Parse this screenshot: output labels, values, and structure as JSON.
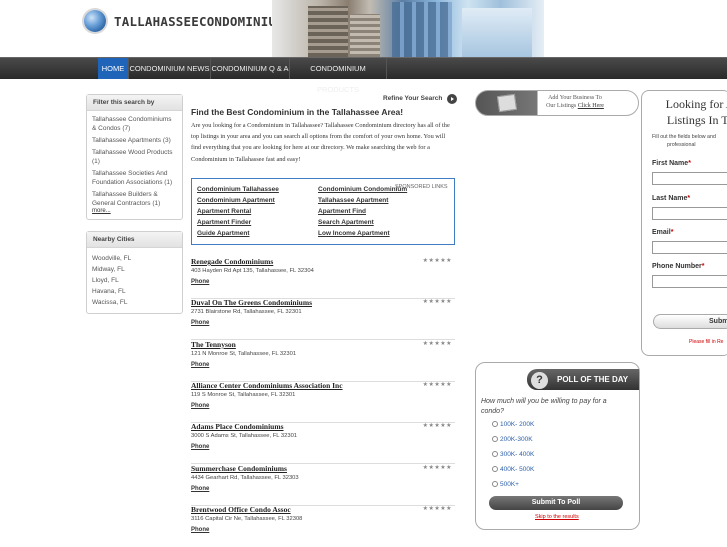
{
  "site": {
    "logo_text": "TALLAHASSEECONDOMINIUM.COM"
  },
  "nav": {
    "items": [
      "HOME",
      "CONDOMINIUM NEWS",
      "CONDOMINIUM Q & A",
      "CONDOMINIUM PRODUCTS"
    ],
    "active": "HOME"
  },
  "filter": {
    "title": "Filter this search by",
    "items": [
      "Tallahassee Condominiums",
      "& Condos (7)",
      "Tallahassee Apartments (3)",
      "Tallahassee Wood Products",
      "(1)",
      "Tallahassee Societies And",
      "Foundation Associations (1)",
      "Tallahassee Builders &",
      "General Contractors (1)"
    ],
    "more": "more..."
  },
  "nearby": {
    "title": "Nearby Cities",
    "cities": [
      "Woodville, FL",
      "Midway, FL",
      "Lloyd, FL",
      "Havana, FL",
      "Wacissa, FL"
    ]
  },
  "main": {
    "refine": "Refine Your Search",
    "title": "Find the Best Condominium in the Tallahassee Area!",
    "intro": "Are you looking for a Condominium in Tallahassee? Tallahassee Condominium directory has all of the top listings in your area and you can search all options from the comfort of your own home. You will find everything that you are looking for here at our directory. We make searching the web for a Condominium in Tallahassee fast and easy!"
  },
  "sponsored": {
    "label": "SPONSORED LINKS",
    "left": [
      "Condominium Tallahassee",
      "Condominium Apartment",
      "Apartment Rental",
      "Apartment Finder",
      "Guide Apartment"
    ],
    "right": [
      "Condominium Condominium",
      "Tallahassee Apartment",
      "Apartment Find",
      "Search Apartment",
      "Low Income Apartment"
    ]
  },
  "listings": [
    {
      "name": "Renegade Condominiums",
      "address": "403 Hayden Rd Apt 135, Tallahassee, FL 32304",
      "phone": "Phone",
      "stars": "★★★★★"
    },
    {
      "name": "Duval On The Greens Condominiums",
      "address": "2731 Blairstone Rd, Tallahassee, FL 32301",
      "phone": "Phone",
      "stars": "★★★★★"
    },
    {
      "name": "The Tennyson",
      "address": "121 N Monroe St, Tallahassee, FL 32301",
      "phone": "Phone",
      "stars": "★★★★★"
    },
    {
      "name": "Alliance Center Condominiums Association Inc",
      "address": "119 S Monroe St, Tallahassee, FL 32301",
      "phone": "Phone",
      "stars": "★★★★★"
    },
    {
      "name": "Adams Place Condominiums",
      "address": "3000 S Adams St, Tallahassee, FL 32301",
      "phone": "Phone",
      "stars": "★★★★★"
    },
    {
      "name": "Summerchase Condominiums",
      "address": "4434 Gearhart Rd, Tallahassee, FL 32303",
      "phone": "Phone",
      "stars": "★★★★★"
    },
    {
      "name": "Brentwood Office Condo Assoc",
      "address": "3116 Capital Cir Ne, Tallahassee, FL 32308",
      "phone": "Phone",
      "stars": "★★★★★"
    }
  ],
  "ad": {
    "line1": "Add Your Business To",
    "line2": "Our Listings",
    "link": "Click Here"
  },
  "form": {
    "title_line1": "Looking for A",
    "title_line2": "Listings In Ta",
    "desc_line1": "Fill out the fields below and",
    "desc_line2": "professional",
    "fields": [
      "First Name",
      "Last Name",
      "Email",
      "Phone Number"
    ],
    "required_mark": "*",
    "submit": "Subm",
    "note": "Please fill in Re"
  },
  "poll": {
    "title": "POLL OF THE DAY",
    "icon": "?",
    "question": "How much will you be willing to pay for a condo?",
    "options": [
      "100K- 200K",
      "200K-300K",
      "300K- 400K",
      "400K- 500K",
      "500K+"
    ],
    "submit": "Submit To Poll",
    "skip": "Skip to the results"
  }
}
